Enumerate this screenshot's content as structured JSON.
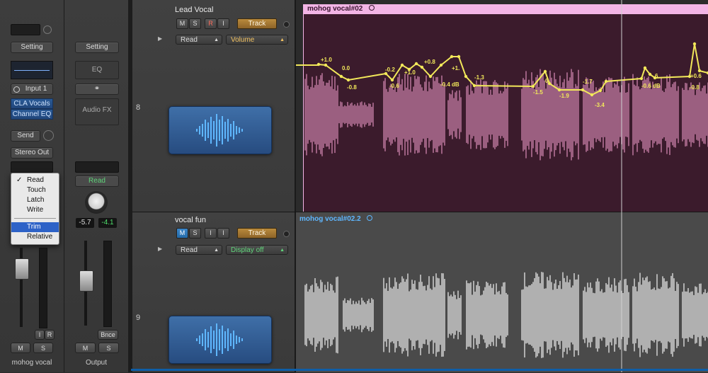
{
  "mixer": {
    "left_strip": {
      "setting": "Setting",
      "input": "Input 1",
      "plugins": [
        "CLA Vocals",
        "Channel EQ"
      ],
      "send": "Send",
      "output": "Stereo Out",
      "automation_menu": {
        "items": [
          "Read",
          "Touch",
          "Latch",
          "Write"
        ],
        "checked": "Read",
        "sub_items": [
          "Trim",
          "Relative"
        ],
        "highlighted": "Trim"
      },
      "ir": [
        "I",
        "R"
      ],
      "ms": [
        "M",
        "S"
      ],
      "name": "mohog vocal"
    },
    "right_strip": {
      "setting": "Setting",
      "eq": "EQ",
      "audio_fx": "Audio FX",
      "automation_mode": "Read",
      "volume_left": "-5.7",
      "volume_right": "-4.1",
      "bnce": "Bnce",
      "ms": [
        "M",
        "S"
      ],
      "name": "Output"
    }
  },
  "tracks": [
    {
      "number": "8",
      "name": "Lead Vocal",
      "buttons": [
        "M",
        "S",
        "R",
        "I"
      ],
      "track_btn": "Track",
      "mode": "Read",
      "param": "Volume",
      "region": "mohog vocal#02",
      "automation_labels": [
        "+1.0",
        "0.0",
        "-0.8",
        "-0.2",
        "-0.6",
        "+1.0",
        "+0.8",
        "+1.",
        "-0.4 dB",
        "-1.3",
        "-1.5",
        "0.",
        "-1.9",
        "-1.7",
        "-3.4",
        "-0.6 dB",
        "6",
        "-0.8",
        "+0.6"
      ]
    },
    {
      "number": "9",
      "name": "vocal fun",
      "buttons": [
        "M",
        "S",
        "I",
        "I"
      ],
      "track_btn": "Track",
      "mode": "Read",
      "param": "Display off",
      "region": "mohog vocal#02.2"
    }
  ],
  "colors": {
    "region1_bg": "#3b1b2c",
    "region1_header": "#f3b5e6",
    "region1_wave": "#9b5f80",
    "region2_bg": "#4a4a4a",
    "region2_wave": "#b0b0b0",
    "automation": "#f2e85a",
    "playhead": "#cfcfcf"
  }
}
